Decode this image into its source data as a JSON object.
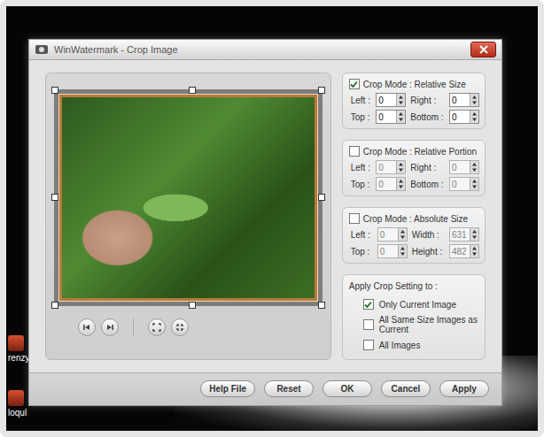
{
  "window": {
    "title": "WinWatermark - Crop Image"
  },
  "desktop_icons": [
    {
      "label": "renzy"
    },
    {
      "label": "loqul"
    }
  ],
  "crop_modes": [
    {
      "title": "Crop Mode : Relative Size",
      "checked": true,
      "fields": [
        {
          "label": "Left :",
          "value": "0",
          "disabled": false
        },
        {
          "label": "Right :",
          "value": "0",
          "disabled": false
        },
        {
          "label": "Top :",
          "value": "0",
          "disabled": false
        },
        {
          "label": "Bottom :",
          "value": "0",
          "disabled": false
        }
      ]
    },
    {
      "title": "Crop Mode : Relative Portion",
      "checked": false,
      "fields": [
        {
          "label": "Left :",
          "value": "0",
          "disabled": true
        },
        {
          "label": "Right :",
          "value": "0",
          "disabled": true
        },
        {
          "label": "Top :",
          "value": "0",
          "disabled": true
        },
        {
          "label": "Bottom :",
          "value": "0",
          "disabled": true
        }
      ]
    },
    {
      "title": "Crop Mode : Absolute Size",
      "checked": false,
      "fields": [
        {
          "label": "Left :",
          "value": "0",
          "disabled": true
        },
        {
          "label": "Width :",
          "value": "631",
          "disabled": true
        },
        {
          "label": "Top :",
          "value": "0",
          "disabled": true
        },
        {
          "label": "Height :",
          "value": "482",
          "disabled": true
        }
      ]
    }
  ],
  "apply": {
    "title": "Apply Crop Setting to :",
    "options": [
      {
        "label": "Only Current Image",
        "checked": true
      },
      {
        "label": "All Same Size Images as Current",
        "checked": false
      },
      {
        "label": "All Images",
        "checked": false
      }
    ]
  },
  "buttons": [
    "Help File",
    "Reset",
    "OK",
    "Cancel",
    "Apply"
  ]
}
